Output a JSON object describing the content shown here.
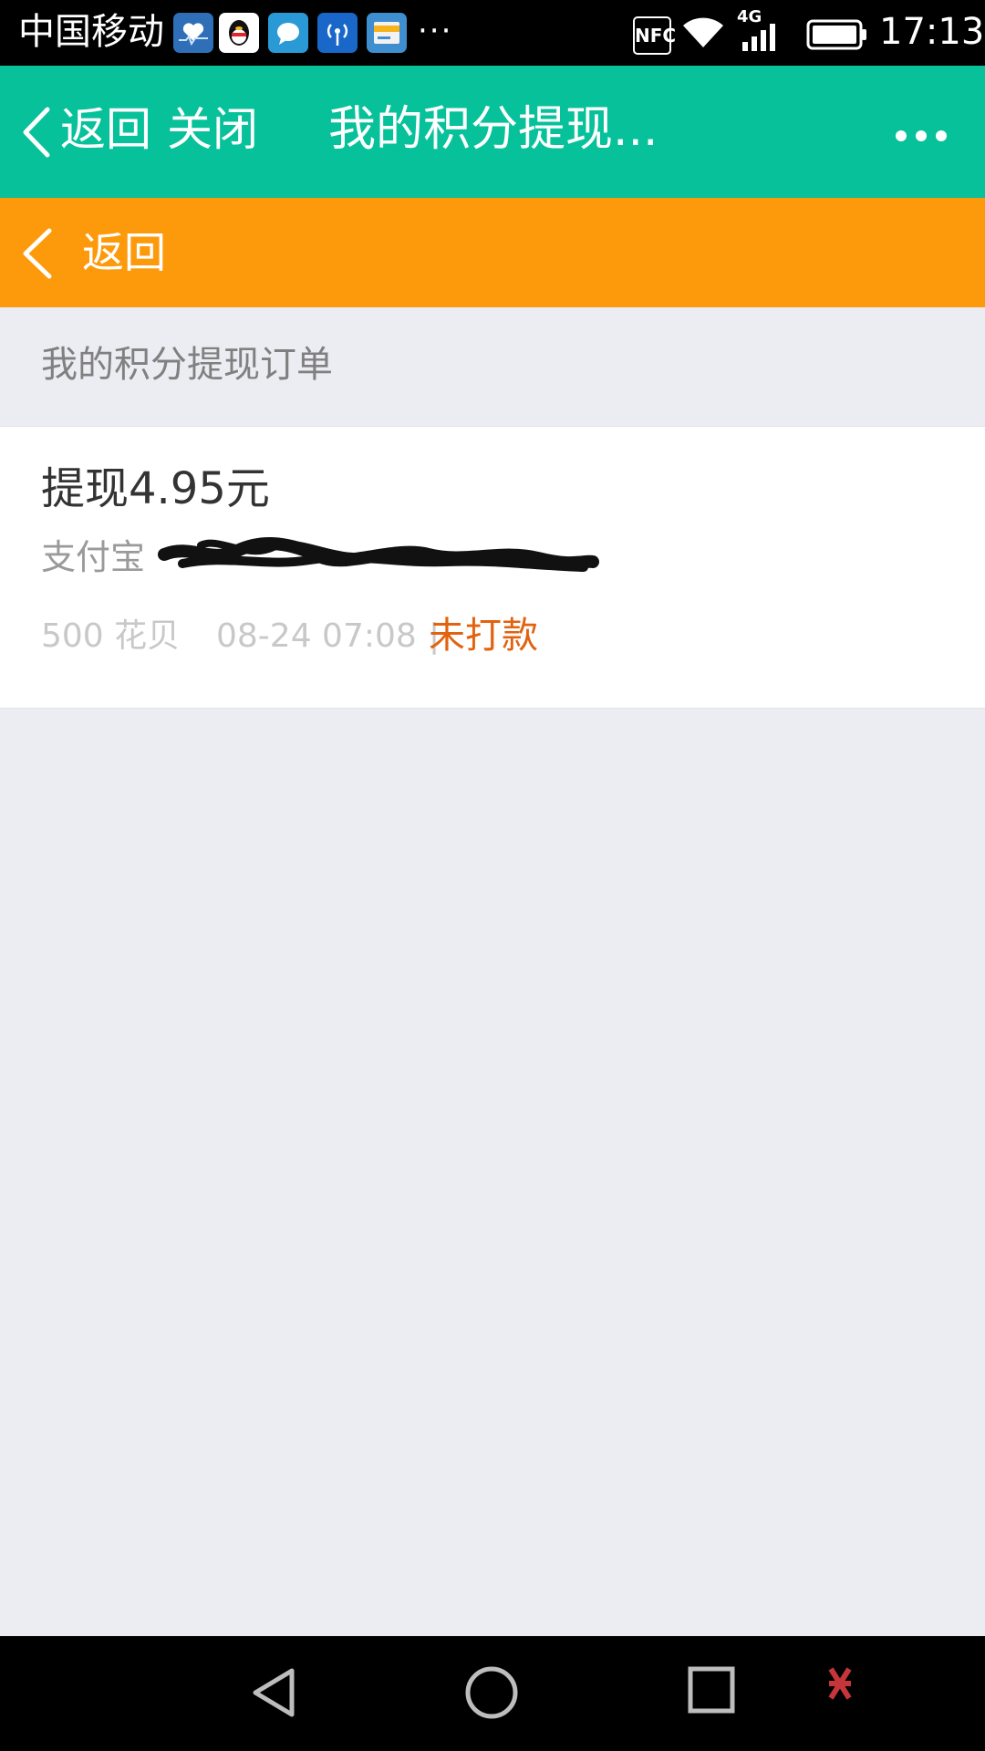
{
  "status_bar": {
    "carrier": "中国移动",
    "more": "···",
    "nfc_label": "NFC",
    "network": "4G",
    "time": "17:13",
    "notification_icons": [
      "health-icon",
      "qq-icon",
      "message-icon",
      "hotspot-icon",
      "card-icon"
    ],
    "colors": {
      "health": "#2e6fb8",
      "qq": "#ffffff",
      "message": "#2a9ad6",
      "hotspot": "#1967c8",
      "card": "#3f8fd0"
    }
  },
  "title_bar": {
    "back_label": "返回",
    "close_label": "关闭",
    "title": "我的积分提现..."
  },
  "sub_bar": {
    "back_label": "返回"
  },
  "section": {
    "title": "我的积分提现订单"
  },
  "order": {
    "amount": "提现4.95元",
    "account_prefix": "支付宝",
    "points": "500 花贝",
    "datetime": "08-24 07:08",
    "separator": "|",
    "status": "未打款"
  },
  "colors": {
    "title_bar": "#06c19a",
    "sub_bar": "#fd9a0c",
    "status_text": "#e2620f",
    "background": "#ecedf2"
  }
}
